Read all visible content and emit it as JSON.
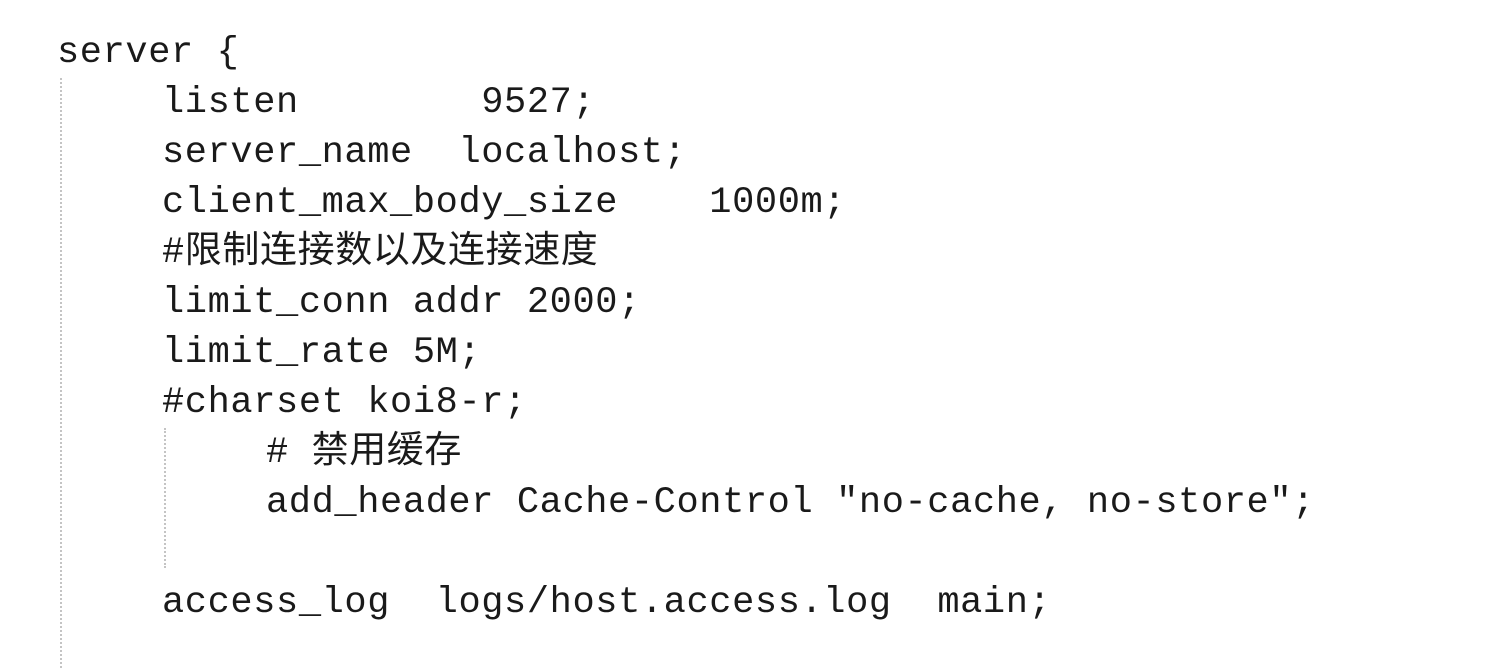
{
  "code": {
    "lines": [
      "server {",
      "listen        9527;",
      "server_name  localhost;",
      "client_max_body_size    1000m;",
      "#限制连接数以及连接速度",
      "limit_conn addr 2000;",
      "limit_rate 5M;",
      "#charset koi8-r;",
      "# 禁用缓存",
      "add_header Cache-Control \"no-cache, no-store\";",
      "access_log  logs/host.access.log  main;"
    ]
  },
  "colors": {
    "background": "#ffffff",
    "text": "#1a1a1a",
    "indent_guide": "#c4c4c4"
  }
}
